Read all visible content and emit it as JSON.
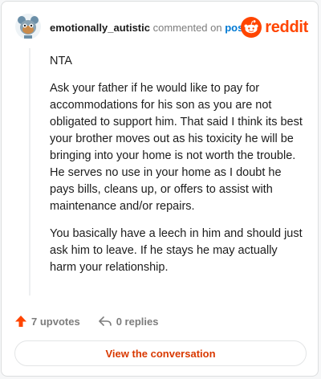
{
  "comment": {
    "username": "emotionally_autistic",
    "action_text": "commented on",
    "post_link": "post",
    "paragraphs": [
      "NTA",
      "Ask your father if he would like to pay for accommodations for his son as you are not obligated to support him. That said I think its best your brother moves out as his toxicity he will be bringing into your home is not worth the trouble. He serves no use in your home as I doubt he pays bills, cleans up, or offers to assist with maintenance and/or repairs.",
      "You basically have a leech in him and should just ask him to leave. If he stays he may actually harm your relationship."
    ]
  },
  "brand": {
    "name": "reddit",
    "icon": "reddit-snoo-icon",
    "color": "#ff4500"
  },
  "footer": {
    "upvotes": "7 upvotes",
    "replies": "0 replies",
    "upvote_icon": "upvote-arrow-icon",
    "reply_icon": "reply-arrow-icon",
    "upvote_color": "#ff4500"
  },
  "cta": {
    "label": "View the conversation"
  }
}
